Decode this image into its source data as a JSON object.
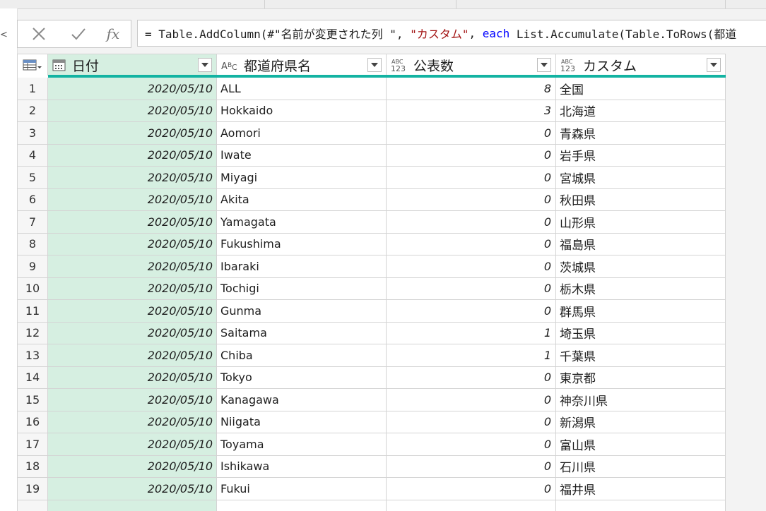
{
  "formula": {
    "prefix": "= Table.AddColumn(#\"名前が変更された列 \", ",
    "string": "\"カスタム\"",
    "sep": ", ",
    "keyword": "each",
    "rest": " List.Accumulate(Table.ToRows(都道"
  },
  "formula_buttons": {
    "fx": "fx"
  },
  "icons": {
    "cancel": "close-icon",
    "commit": "check-icon",
    "table": "table-menu-icon"
  },
  "columns": [
    {
      "label": "日付",
      "type_icon": "date-type-icon"
    },
    {
      "label": "都道府県名",
      "type_icon": "text-type-icon"
    },
    {
      "label": "公表数",
      "type_icon": "any-type-icon"
    },
    {
      "label": "カスタム",
      "type_icon": "any-type-icon"
    }
  ],
  "rows": [
    {
      "n": "1",
      "date": "2020/05/10",
      "pref": "ALL",
      "count": "8",
      "custom": "全国"
    },
    {
      "n": "2",
      "date": "2020/05/10",
      "pref": "Hokkaido",
      "count": "3",
      "custom": "北海道"
    },
    {
      "n": "3",
      "date": "2020/05/10",
      "pref": "Aomori",
      "count": "0",
      "custom": "青森県"
    },
    {
      "n": "4",
      "date": "2020/05/10",
      "pref": "Iwate",
      "count": "0",
      "custom": "岩手県"
    },
    {
      "n": "5",
      "date": "2020/05/10",
      "pref": "Miyagi",
      "count": "0",
      "custom": "宮城県"
    },
    {
      "n": "6",
      "date": "2020/05/10",
      "pref": "Akita",
      "count": "0",
      "custom": "秋田県"
    },
    {
      "n": "7",
      "date": "2020/05/10",
      "pref": "Yamagata",
      "count": "0",
      "custom": "山形県"
    },
    {
      "n": "8",
      "date": "2020/05/10",
      "pref": "Fukushima",
      "count": "0",
      "custom": "福島県"
    },
    {
      "n": "9",
      "date": "2020/05/10",
      "pref": "Ibaraki",
      "count": "0",
      "custom": "茨城県"
    },
    {
      "n": "10",
      "date": "2020/05/10",
      "pref": "Tochigi",
      "count": "0",
      "custom": "栃木県"
    },
    {
      "n": "11",
      "date": "2020/05/10",
      "pref": "Gunma",
      "count": "0",
      "custom": "群馬県"
    },
    {
      "n": "12",
      "date": "2020/05/10",
      "pref": "Saitama",
      "count": "1",
      "custom": "埼玉県"
    },
    {
      "n": "13",
      "date": "2020/05/10",
      "pref": "Chiba",
      "count": "1",
      "custom": "千葉県"
    },
    {
      "n": "14",
      "date": "2020/05/10",
      "pref": "Tokyo",
      "count": "0",
      "custom": "東京都"
    },
    {
      "n": "15",
      "date": "2020/05/10",
      "pref": "Kanagawa",
      "count": "0",
      "custom": "神奈川県"
    },
    {
      "n": "16",
      "date": "2020/05/10",
      "pref": "Niigata",
      "count": "0",
      "custom": "新潟県"
    },
    {
      "n": "17",
      "date": "2020/05/10",
      "pref": "Toyama",
      "count": "0",
      "custom": "富山県"
    },
    {
      "n": "18",
      "date": "2020/05/10",
      "pref": "Ishikawa",
      "count": "0",
      "custom": "石川県"
    },
    {
      "n": "19",
      "date": "2020/05/10",
      "pref": "Fukui",
      "count": "0",
      "custom": "福井県"
    }
  ]
}
